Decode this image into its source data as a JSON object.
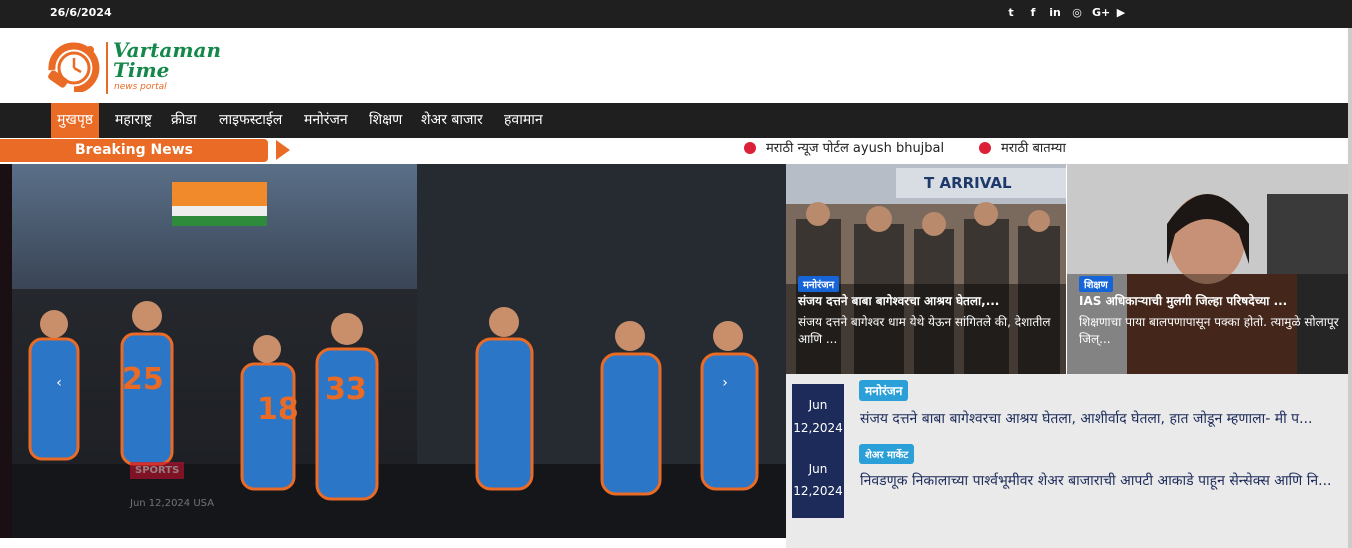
{
  "topbar": {
    "date": "26/6/2024",
    "social": [
      {
        "icon": "twitter-icon",
        "glyph": "t"
      },
      {
        "icon": "facebook-icon",
        "glyph": "f"
      },
      {
        "icon": "linkedin-icon",
        "glyph": "in"
      },
      {
        "icon": "instagram-icon",
        "glyph": "◎"
      },
      {
        "icon": "google-plus-icon",
        "glyph": "G+"
      },
      {
        "icon": "youtube-icon",
        "glyph": "▶"
      }
    ]
  },
  "brand": {
    "line1": "Vartaman",
    "line2": "Time",
    "tagline": "news portal"
  },
  "nav": {
    "items": [
      "मुखपृष्ठ",
      "महाराष्ट्र",
      "क्रीडा",
      "लाइफस्टाईल",
      "मनोरंजन",
      "शिक्षण",
      "शेअर बाजार",
      "हवामान"
    ],
    "active": "मुखपृष्ठ"
  },
  "ticker": {
    "label": "Breaking News",
    "items": [
      "मराठी न्यूज पोर्टल ayush bhujbal",
      "मराठी बातम्या"
    ]
  },
  "slider": {
    "tag": "SPORTS",
    "meta": "Jun 12,2024   USA",
    "prev_icon": "‹",
    "next_icon": "›"
  },
  "cards": [
    {
      "tag": "मनोरंजन",
      "title": "संजय दत्तने बाबा बागेश्वरचा आश्रय घेतला,...",
      "excerpt": "संजय दत्तने बागेश्वर धाम येथे येऊन सांगितले की, देशातील आणि ..."
    },
    {
      "tag": "शिक्षण",
      "title": "IAS अधिकाऱ्याची मुलगी जिल्हा परिषदेच्या ...",
      "excerpt": "शिक्षणाचा पाया बालपणापासून पक्का होतो. त्यामुळे सोलापूर जिल्..."
    }
  ],
  "list": {
    "dates": [
      "Jun",
      "12,2024",
      "Jun",
      "12,2024"
    ],
    "items": [
      {
        "tag": "मनोरंजन",
        "title": "संजय दत्तने बाबा बागेश्वरचा आश्रय घेतला, आशीर्वाद घेतला, हात जोडून म्हणाला- मी प..."
      },
      {
        "tag": "शेअर मार्केट",
        "title": "निवडणूक निकालाच्या पार्श्वभूमीवर शेअर बाजाराची आपटी आकाडे पाहून सेन्सेक्स आणि नि..."
      }
    ]
  },
  "colors": {
    "accent": "#e96b25",
    "brand_green": "#15874a",
    "dark": "#1f1f1f",
    "navy": "#1d2b5a",
    "tag_blue": "#2a9fd8",
    "dot_red": "#dc2038"
  }
}
